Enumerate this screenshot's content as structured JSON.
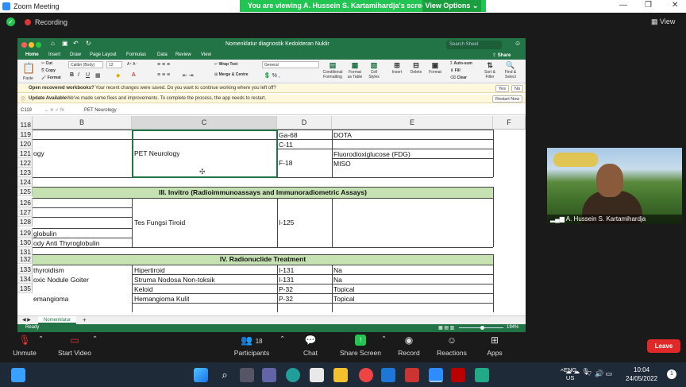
{
  "zoom": {
    "app_title": "Zoom Meeting",
    "viewing_banner": "You are viewing A. Hussein S. Kartamihardja's screen",
    "view_options": "View Options",
    "recording": "Recording",
    "view": "View"
  },
  "excel": {
    "doc_title": "Nomenklatur diagnostik Kedokteran Nuklir",
    "search_placeholder": "Search Sheet",
    "ribbon_tabs": [
      "Home",
      "Insert",
      "Draw",
      "Page Layout",
      "Formulas",
      "Data",
      "Review",
      "View"
    ],
    "share": "Share",
    "ribbon": {
      "paste": "Paste",
      "cut": "Cut",
      "copy": "Copy",
      "format": "Format",
      "font": "Calibri (Body)",
      "font_size": "12",
      "wrap_text": "Wrap Text",
      "merge_center": "Merge & Centre",
      "number_format": "General",
      "conditional": "Conditional Formatting",
      "format_table": "Format as Table",
      "cell_styles": "Cell Styles",
      "insert": "Insert",
      "delete": "Delete",
      "format2": "Format",
      "autosum": "Auto-sum",
      "fill": "Fill",
      "clear": "Clear",
      "sort_filter": "Sort & Filter",
      "find_select": "Find & Select"
    },
    "notice1": {
      "title": "Open recovered workbooks?",
      "text": "Your recent changes were saved. Do you want to continue working where you left off?",
      "yes": "Yes",
      "no": "No"
    },
    "notice2": {
      "title": "Update Available",
      "text": "We've made some fixes and improvements. To complete the process, the app needs to restart.",
      "restart": "Restart Now"
    },
    "name_box": "C119",
    "formula_value": "PET Neurology",
    "columns": [
      "B",
      "C",
      "D",
      "E",
      "F"
    ],
    "rows": [
      "118",
      "119",
      "120",
      "121",
      "122",
      "123",
      "124",
      "125",
      "126",
      "127",
      "128",
      "129",
      "130",
      "131",
      "132",
      "133",
      "134",
      "135"
    ],
    "cells": {
      "b119": "ogy",
      "c119": "PET Neurology",
      "d119": "Ga-68",
      "e119": "DOTA",
      "d120": "C-11",
      "d121": "F-18",
      "e121": "Fluorodioxiglucose (FDG)",
      "e122": "MISO",
      "section124": "III. Invitro (Radioimmunoassays and Immunoradiometric Assays)",
      "c127": "Tes Fungsi Tiroid",
      "d127": "I-125",
      "b128": "globulin",
      "b129": "ody Anti Thyroglobulin",
      "section131": "IV. Radionuclide Treatment",
      "b132": "thyroidism",
      "c132": "Hipertiroid",
      "d132": "I-131",
      "e132": "Na",
      "b133": "oxic Nodule Goiter",
      "c133": "Struma Nodosa Non-toksik",
      "d133": "I-131",
      "e133": "Na",
      "c134": "Keloid",
      "d134": "P-32",
      "e134": "Topical",
      "b135": "emangioma",
      "c135": "Hemangioma Kulit",
      "d135": "P-32",
      "e135": "Topical"
    },
    "sheet_tab": "Nomenklatur",
    "status": "Ready",
    "zoom_level": "194%"
  },
  "participant": {
    "name": "A. Hussein S. Kartamihardja"
  },
  "toolbar": {
    "unmute": "Unmute",
    "start_video": "Start Video",
    "participants": "Participants",
    "participants_count": "18",
    "chat": "Chat",
    "share_screen": "Share Screen",
    "record": "Record",
    "reactions": "Reactions",
    "apps": "Apps",
    "leave": "Leave"
  },
  "taskbar": {
    "lang1": "ENG",
    "lang2": "US",
    "time": "10:04",
    "date": "24/05/2022",
    "notifications": "1"
  },
  "colors": {
    "excel_green": "#227447",
    "zoom_green": "#23c552",
    "leave_red": "#e02828",
    "section_fill": "#c6e2b3"
  }
}
